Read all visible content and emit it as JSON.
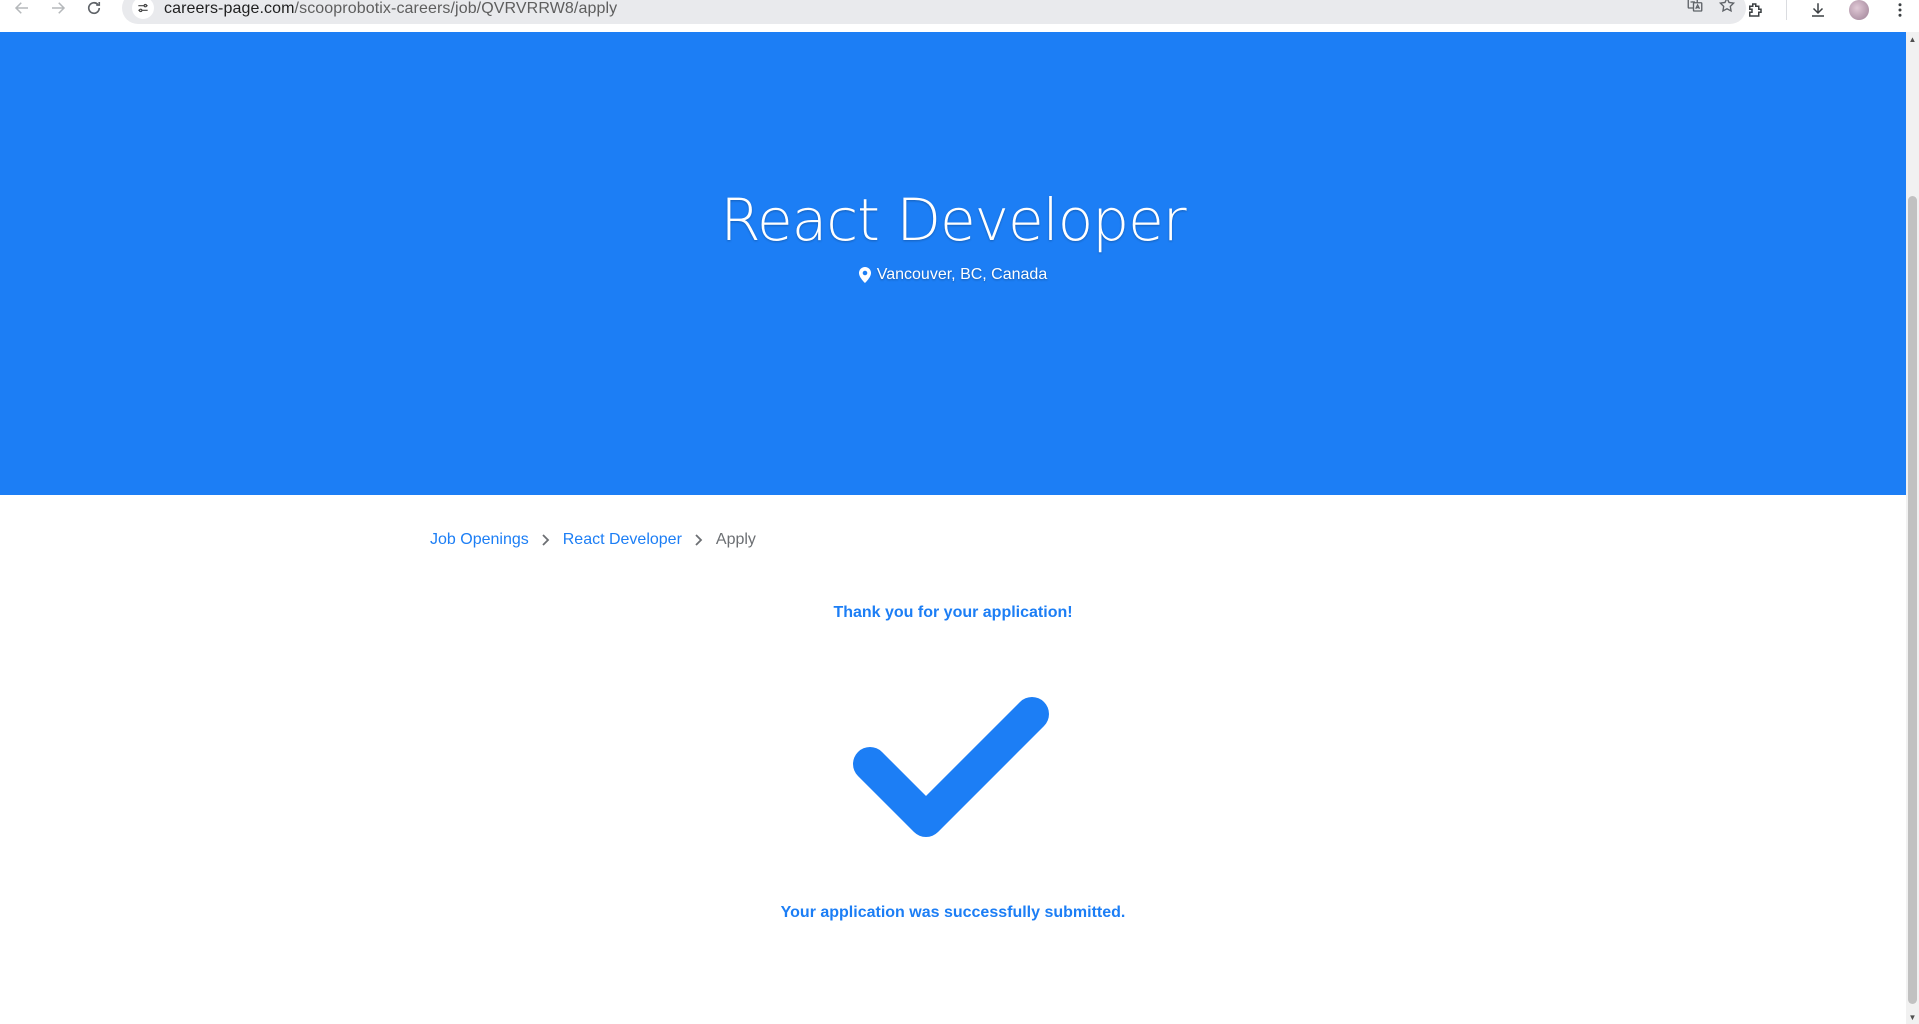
{
  "browser": {
    "url_host": "careers-page.com",
    "url_path": "/scooprobotix-careers/job/QVRVRRW8/apply"
  },
  "hero": {
    "title": "React Developer",
    "location": "Vancouver, BC, Canada",
    "background_color": "#1c7ef5"
  },
  "breadcrumb": {
    "items": [
      {
        "label": "Job Openings"
      },
      {
        "label": "React Developer"
      },
      {
        "label": "Apply"
      }
    ]
  },
  "confirmation": {
    "heading": "Thank you for your application!",
    "icon": "checkmark-icon",
    "message": "Your application was successfully submitted.",
    "accent_color": "#1c7ef5"
  }
}
